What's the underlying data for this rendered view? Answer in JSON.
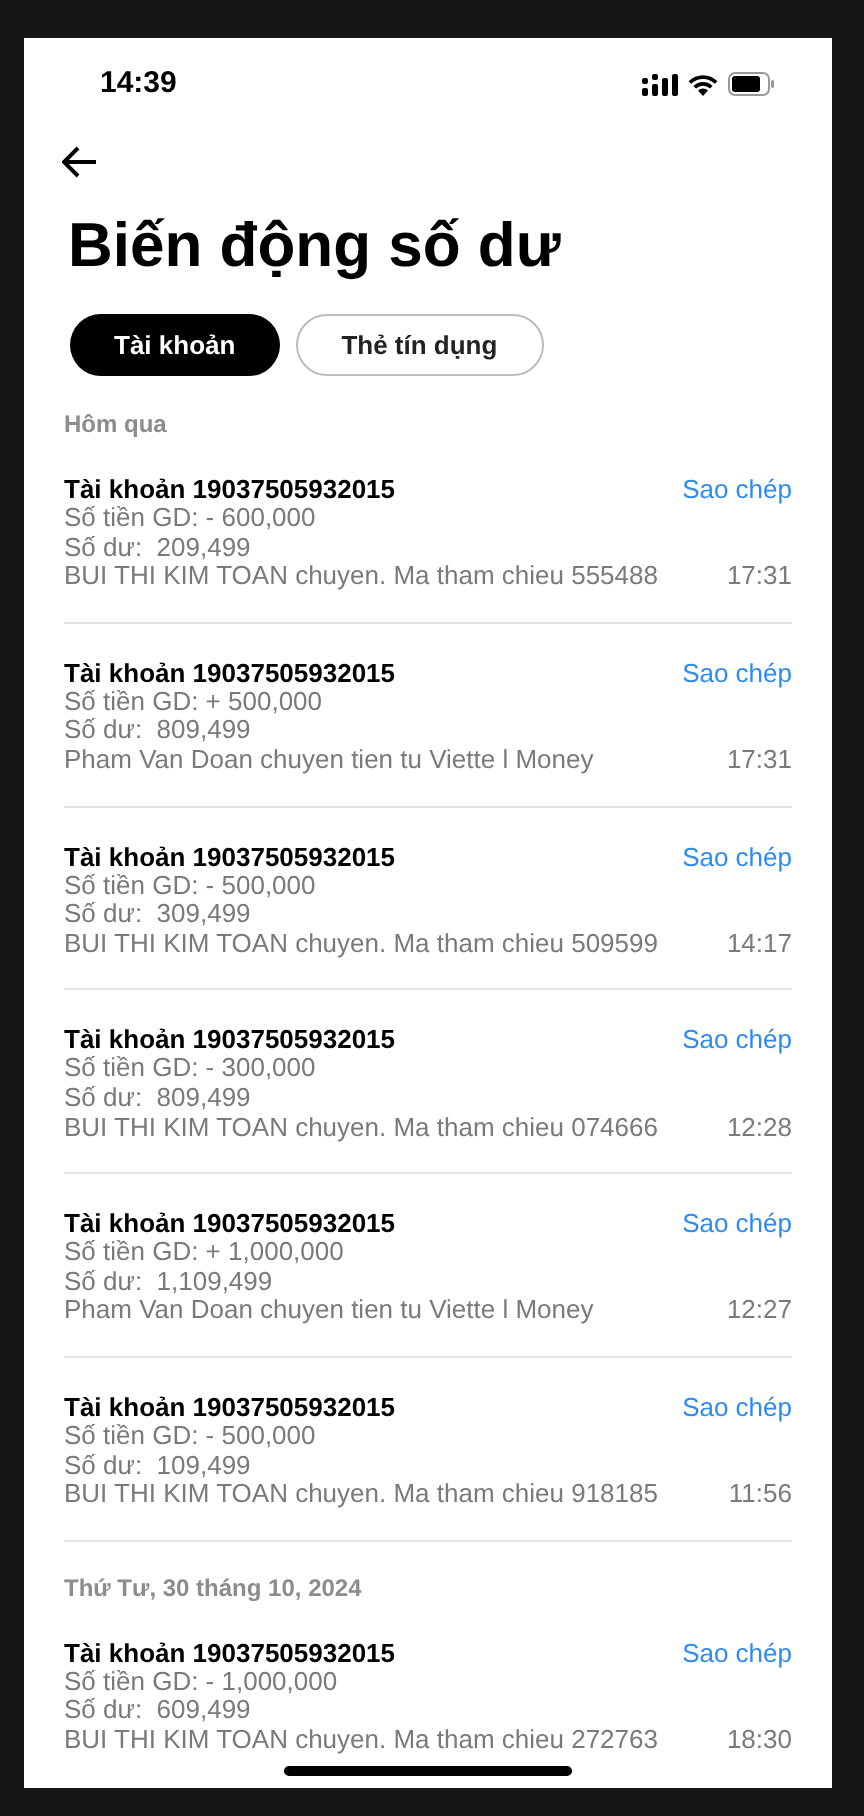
{
  "status_bar": {
    "time": "14:39"
  },
  "title": "Biến động số dư",
  "tabs": [
    {
      "label": "Tài khoản",
      "selected": true
    },
    {
      "label": "Thẻ tín dụng",
      "selected": false
    }
  ],
  "sections": [
    {
      "label": "Hôm qua",
      "items": [
        {
          "account": "Tài khoản 19037505932015",
          "action": "Sao chép",
          "amount": "Số tiền GD: - 600,000",
          "balance": "Số dư:  209,499",
          "description": "BUI THI KIM TOAN chuyen. Ma tham chieu 555488",
          "time": "17:31"
        },
        {
          "account": "Tài khoản 19037505932015",
          "action": "Sao chép",
          "amount": "Số tiền GD: + 500,000",
          "balance": "Số dư:  809,499",
          "description": "Pham Van Doan chuyen tien tu Viette l Money",
          "time": "17:31"
        },
        {
          "account": "Tài khoản 19037505932015",
          "action": "Sao chép",
          "amount": "Số tiền GD: - 500,000",
          "balance": "Số dư:  309,499",
          "description": "BUI THI KIM TOAN chuyen. Ma tham chieu 509599",
          "time": "14:17"
        },
        {
          "account": "Tài khoản 19037505932015",
          "action": "Sao chép",
          "amount": "Số tiền GD: - 300,000",
          "balance": "Số dư:  809,499",
          "description": "BUI THI KIM TOAN chuyen. Ma tham chieu 074666",
          "time": "12:28"
        },
        {
          "account": "Tài khoản 19037505932015",
          "action": "Sao chép",
          "amount": "Số tiền GD: + 1,000,000",
          "balance": "Số dư:  1,109,499",
          "description": "Pham Van Doan chuyen tien tu Viette l Money",
          "time": "12:27"
        },
        {
          "account": "Tài khoản 19037505932015",
          "action": "Sao chép",
          "amount": "Số tiền GD: - 500,000",
          "balance": "Số dư:  109,499",
          "description": "BUI THI KIM TOAN chuyen. Ma tham chieu 918185",
          "time": "11:56"
        }
      ]
    },
    {
      "label": "Thứ Tư, 30 tháng 10, 2024",
      "items": [
        {
          "account": "Tài khoản 19037505932015",
          "action": "Sao chép",
          "amount": "Số tiền GD: - 1,000,000",
          "balance": "Số dư:  609,499",
          "description": "BUI THI KIM TOAN chuyen. Ma tham chieu 272763",
          "time": "18:30"
        }
      ]
    }
  ]
}
